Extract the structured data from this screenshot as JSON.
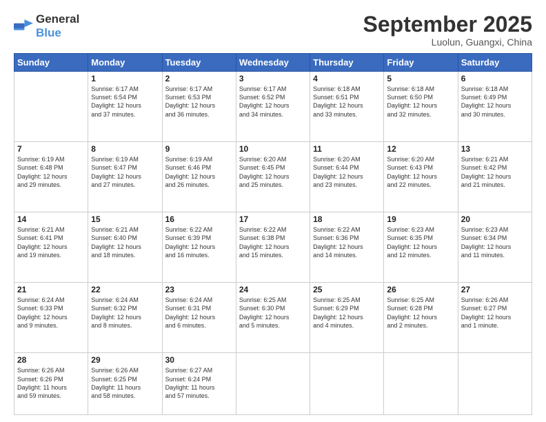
{
  "header": {
    "logo": {
      "text_general": "General",
      "text_blue": "Blue"
    },
    "title": "September 2025",
    "location": "Luolun, Guangxi, China"
  },
  "calendar": {
    "headers": [
      "Sunday",
      "Monday",
      "Tuesday",
      "Wednesday",
      "Thursday",
      "Friday",
      "Saturday"
    ],
    "rows": [
      [
        {
          "day": "",
          "text": ""
        },
        {
          "day": "1",
          "text": "Sunrise: 6:17 AM\nSunset: 6:54 PM\nDaylight: 12 hours\nand 37 minutes."
        },
        {
          "day": "2",
          "text": "Sunrise: 6:17 AM\nSunset: 6:53 PM\nDaylight: 12 hours\nand 36 minutes."
        },
        {
          "day": "3",
          "text": "Sunrise: 6:17 AM\nSunset: 6:52 PM\nDaylight: 12 hours\nand 34 minutes."
        },
        {
          "day": "4",
          "text": "Sunrise: 6:18 AM\nSunset: 6:51 PM\nDaylight: 12 hours\nand 33 minutes."
        },
        {
          "day": "5",
          "text": "Sunrise: 6:18 AM\nSunset: 6:50 PM\nDaylight: 12 hours\nand 32 minutes."
        },
        {
          "day": "6",
          "text": "Sunrise: 6:18 AM\nSunset: 6:49 PM\nDaylight: 12 hours\nand 30 minutes."
        }
      ],
      [
        {
          "day": "7",
          "text": "Sunrise: 6:19 AM\nSunset: 6:48 PM\nDaylight: 12 hours\nand 29 minutes."
        },
        {
          "day": "8",
          "text": "Sunrise: 6:19 AM\nSunset: 6:47 PM\nDaylight: 12 hours\nand 27 minutes."
        },
        {
          "day": "9",
          "text": "Sunrise: 6:19 AM\nSunset: 6:46 PM\nDaylight: 12 hours\nand 26 minutes."
        },
        {
          "day": "10",
          "text": "Sunrise: 6:20 AM\nSunset: 6:45 PM\nDaylight: 12 hours\nand 25 minutes."
        },
        {
          "day": "11",
          "text": "Sunrise: 6:20 AM\nSunset: 6:44 PM\nDaylight: 12 hours\nand 23 minutes."
        },
        {
          "day": "12",
          "text": "Sunrise: 6:20 AM\nSunset: 6:43 PM\nDaylight: 12 hours\nand 22 minutes."
        },
        {
          "day": "13",
          "text": "Sunrise: 6:21 AM\nSunset: 6:42 PM\nDaylight: 12 hours\nand 21 minutes."
        }
      ],
      [
        {
          "day": "14",
          "text": "Sunrise: 6:21 AM\nSunset: 6:41 PM\nDaylight: 12 hours\nand 19 minutes."
        },
        {
          "day": "15",
          "text": "Sunrise: 6:21 AM\nSunset: 6:40 PM\nDaylight: 12 hours\nand 18 minutes."
        },
        {
          "day": "16",
          "text": "Sunrise: 6:22 AM\nSunset: 6:39 PM\nDaylight: 12 hours\nand 16 minutes."
        },
        {
          "day": "17",
          "text": "Sunrise: 6:22 AM\nSunset: 6:38 PM\nDaylight: 12 hours\nand 15 minutes."
        },
        {
          "day": "18",
          "text": "Sunrise: 6:22 AM\nSunset: 6:36 PM\nDaylight: 12 hours\nand 14 minutes."
        },
        {
          "day": "19",
          "text": "Sunrise: 6:23 AM\nSunset: 6:35 PM\nDaylight: 12 hours\nand 12 minutes."
        },
        {
          "day": "20",
          "text": "Sunrise: 6:23 AM\nSunset: 6:34 PM\nDaylight: 12 hours\nand 11 minutes."
        }
      ],
      [
        {
          "day": "21",
          "text": "Sunrise: 6:24 AM\nSunset: 6:33 PM\nDaylight: 12 hours\nand 9 minutes."
        },
        {
          "day": "22",
          "text": "Sunrise: 6:24 AM\nSunset: 6:32 PM\nDaylight: 12 hours\nand 8 minutes."
        },
        {
          "day": "23",
          "text": "Sunrise: 6:24 AM\nSunset: 6:31 PM\nDaylight: 12 hours\nand 6 minutes."
        },
        {
          "day": "24",
          "text": "Sunrise: 6:25 AM\nSunset: 6:30 PM\nDaylight: 12 hours\nand 5 minutes."
        },
        {
          "day": "25",
          "text": "Sunrise: 6:25 AM\nSunset: 6:29 PM\nDaylight: 12 hours\nand 4 minutes."
        },
        {
          "day": "26",
          "text": "Sunrise: 6:25 AM\nSunset: 6:28 PM\nDaylight: 12 hours\nand 2 minutes."
        },
        {
          "day": "27",
          "text": "Sunrise: 6:26 AM\nSunset: 6:27 PM\nDaylight: 12 hours\nand 1 minute."
        }
      ],
      [
        {
          "day": "28",
          "text": "Sunrise: 6:26 AM\nSunset: 6:26 PM\nDaylight: 11 hours\nand 59 minutes."
        },
        {
          "day": "29",
          "text": "Sunrise: 6:26 AM\nSunset: 6:25 PM\nDaylight: 11 hours\nand 58 minutes."
        },
        {
          "day": "30",
          "text": "Sunrise: 6:27 AM\nSunset: 6:24 PM\nDaylight: 11 hours\nand 57 minutes."
        },
        {
          "day": "",
          "text": ""
        },
        {
          "day": "",
          "text": ""
        },
        {
          "day": "",
          "text": ""
        },
        {
          "day": "",
          "text": ""
        }
      ]
    ]
  }
}
